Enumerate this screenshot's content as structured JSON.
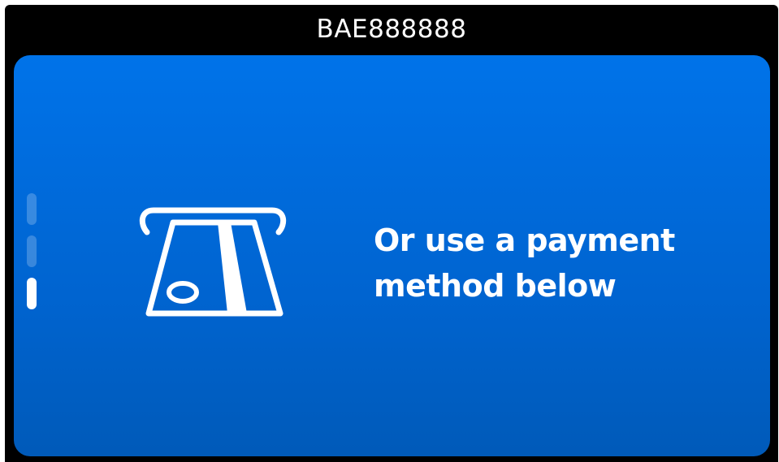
{
  "header": {
    "terminal_id": "BAE888888"
  },
  "screen": {
    "message_line1": "Or use a payment",
    "message_line2": "method below",
    "icon": "card-insert-icon",
    "pager": {
      "count": 3,
      "active_index": 2
    },
    "colors": {
      "background_top": "#0073e9",
      "background_bottom": "#005ab9",
      "foreground": "#ffffff"
    }
  }
}
